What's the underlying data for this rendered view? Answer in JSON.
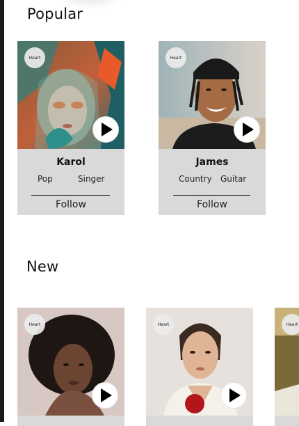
{
  "sections": {
    "popular_title": "Popular",
    "new_title": "New"
  },
  "popular": [
    {
      "name": "Karol",
      "tags": [
        "Pop",
        "Singer"
      ],
      "follow_label": "Follow",
      "heart_label": "Heart"
    },
    {
      "name": "James",
      "tags": [
        "Country",
        "Guitar"
      ],
      "follow_label": "Follow",
      "heart_label": "Heart"
    }
  ],
  "new": [
    {
      "heart_label": "Heart"
    },
    {
      "heart_label": "Heart"
    },
    {
      "heart_label": "Heart"
    }
  ],
  "colors": {
    "card_background": "#d9d9d9",
    "text": "#111111",
    "heart_badge": "#ebebeb",
    "play_button": "#ffffff"
  }
}
